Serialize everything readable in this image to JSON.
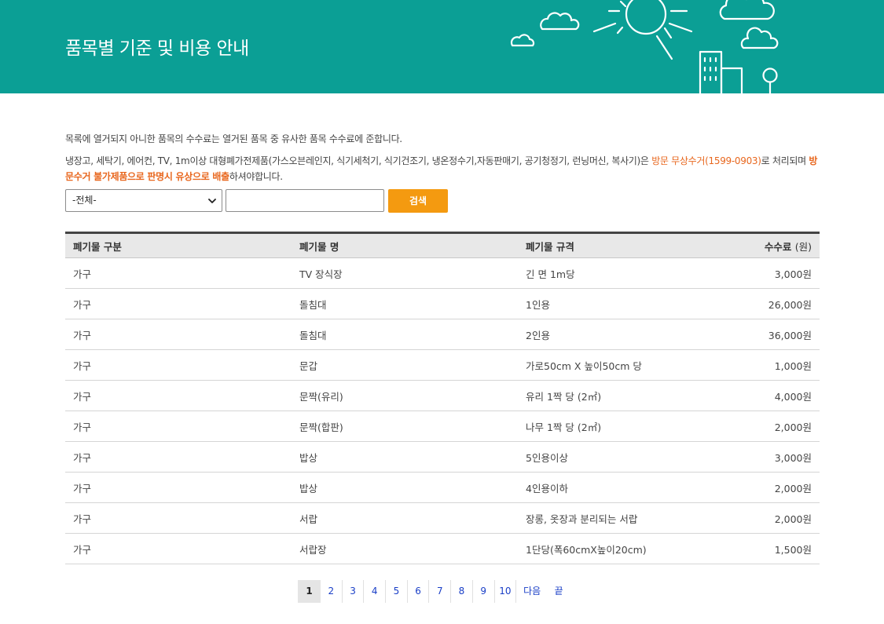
{
  "banner": {
    "title": "품목별 기준 및 비용 안내"
  },
  "notice": {
    "line1": "목록에 열거되지 아니한 품목의 수수료는 열거된 품목 중 유사한 품목 수수료에 준합니다.",
    "line2_part1": "냉장고, 세탁기, 에어컨, TV, 1m이상 대형폐가전제품(가스오븐레인지, 식기세척기, 식기건조기, 냉온정수기,자동판매기, 공기청정기, 런닝머신, 복사기)은 ",
    "line2_orange": "방문 무상수거(1599-0903)",
    "line2_part2": "로 처리되며 ",
    "line2_bold": "방문수거 불가제품으로 판명시 유상으로 배출",
    "line2_part3": "하셔야합니다."
  },
  "search": {
    "select_value": "-전체-",
    "input_value": "",
    "button_label": "검색"
  },
  "table": {
    "headers": {
      "category": "폐기물 구분",
      "name": "폐기물 명",
      "spec": "폐기물 규격",
      "fee": "수수료",
      "fee_unit": "(원)"
    },
    "rows": [
      {
        "category": "가구",
        "name": "TV 장식장",
        "spec": "긴 면 1m당",
        "fee": "3,000원"
      },
      {
        "category": "가구",
        "name": "돌침대",
        "spec": "1인용",
        "fee": "26,000원"
      },
      {
        "category": "가구",
        "name": "돌침대",
        "spec": "2인용",
        "fee": "36,000원"
      },
      {
        "category": "가구",
        "name": "문갑",
        "spec": "가로50cm X 높이50cm 당",
        "fee": "1,000원"
      },
      {
        "category": "가구",
        "name": "문짝(유리)",
        "spec": "유리 1짝 당 (2㎡)",
        "fee": "4,000원"
      },
      {
        "category": "가구",
        "name": "문짝(합판)",
        "spec": "나무 1짝 당 (2㎡)",
        "fee": "2,000원"
      },
      {
        "category": "가구",
        "name": "밥상",
        "spec": "5인용이상",
        "fee": "3,000원"
      },
      {
        "category": "가구",
        "name": "밥상",
        "spec": "4인용이하",
        "fee": "2,000원"
      },
      {
        "category": "가구",
        "name": "서랍",
        "spec": "장롱, 옷장과 분리되는 서랍",
        "fee": "2,000원"
      },
      {
        "category": "가구",
        "name": "서랍장",
        "spec": "1단당(폭60cmX높이20cm)",
        "fee": "1,500원"
      }
    ]
  },
  "pagination": {
    "pages": [
      "1",
      "2",
      "3",
      "4",
      "5",
      "6",
      "7",
      "8",
      "9",
      "10"
    ],
    "current": "1",
    "next_label": "다음",
    "last_label": "끝"
  },
  "colors": {
    "banner_bg": "#0b9f95",
    "accent_orange": "#e8671e",
    "button_orange": "#f49a10",
    "link_blue": "#1a3fc7"
  }
}
